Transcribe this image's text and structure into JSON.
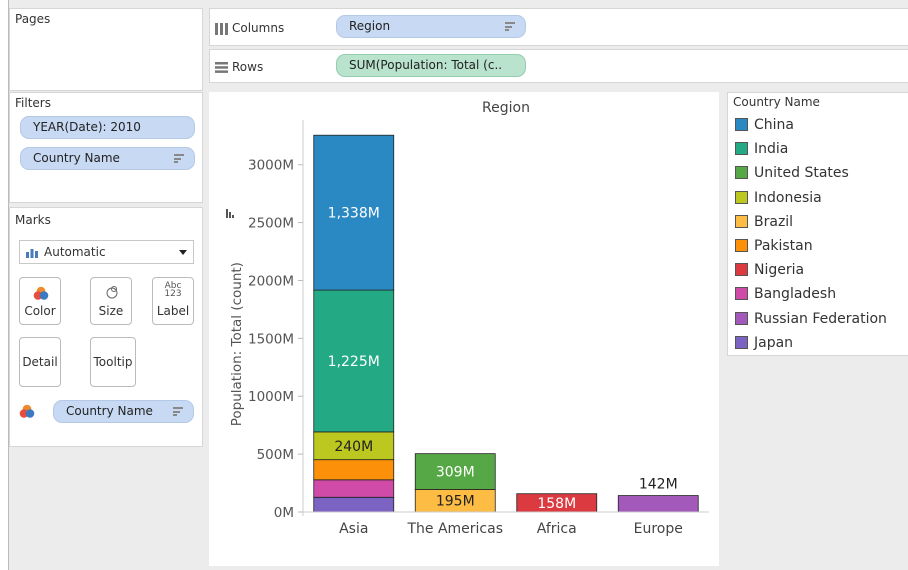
{
  "shelves": {
    "pages_title": "Pages",
    "columns_label": "Columns",
    "rows_label": "Rows",
    "columns_pill": "Region",
    "rows_pill": "SUM(Population: Total (c.."
  },
  "filters": {
    "title": "Filters",
    "items": [
      "YEAR(Date): 2010",
      "Country Name"
    ]
  },
  "marks": {
    "title": "Marks",
    "mark_type": "Automatic",
    "buttons": {
      "color": "Color",
      "size": "Size",
      "label": "Label",
      "label_icon_top": "Abc",
      "label_icon_bottom": "123",
      "detail": "Detail",
      "tooltip": "Tooltip"
    },
    "color_pill": "Country Name"
  },
  "legend": {
    "title": "Country Name",
    "items": [
      {
        "name": "China",
        "color": "#2a88c2"
      },
      {
        "name": "India",
        "color": "#23aa85"
      },
      {
        "name": "United States",
        "color": "#55a845"
      },
      {
        "name": "Indonesia",
        "color": "#bcc71f"
      },
      {
        "name": "Brazil",
        "color": "#fdbc43"
      },
      {
        "name": "Pakistan",
        "color": "#fc9009"
      },
      {
        "name": "Nigeria",
        "color": "#da3a40"
      },
      {
        "name": "Bangladesh",
        "color": "#d04ba8"
      },
      {
        "name": "Russian Federation",
        "color": "#a359b9"
      },
      {
        "name": "Japan",
        "color": "#7b63c4"
      }
    ]
  },
  "chart_data": {
    "type": "bar",
    "title": "Region",
    "xlabel": "",
    "ylabel": "Population: Total (count)",
    "categories": [
      "Asia",
      "The Americas",
      "Africa",
      "Europe"
    ],
    "ylim": [
      0,
      3300
    ],
    "yticks": [
      0,
      500,
      1000,
      1500,
      2000,
      2500,
      3000
    ],
    "ytick_labels": [
      "0M",
      "500M",
      "1000M",
      "1500M",
      "2000M",
      "2500M",
      "3000M"
    ],
    "stacked": true,
    "series": [
      {
        "name": "Japan",
        "values": [
          127,
          0,
          0,
          0
        ]
      },
      {
        "name": "Bangladesh",
        "values": [
          151,
          0,
          0,
          0
        ]
      },
      {
        "name": "Pakistan",
        "values": [
          174,
          0,
          0,
          0
        ]
      },
      {
        "name": "Indonesia",
        "values": [
          240,
          0,
          0,
          0
        ]
      },
      {
        "name": "India",
        "values": [
          1225,
          0,
          0,
          0
        ]
      },
      {
        "name": "China",
        "values": [
          1338,
          0,
          0,
          0
        ]
      },
      {
        "name": "Brazil",
        "values": [
          0,
          195,
          0,
          0
        ]
      },
      {
        "name": "United States",
        "values": [
          0,
          309,
          0,
          0
        ]
      },
      {
        "name": "Nigeria",
        "values": [
          0,
          0,
          158,
          0
        ]
      },
      {
        "name": "Russian Federation",
        "values": [
          0,
          0,
          0,
          142
        ]
      }
    ],
    "data_labels": [
      {
        "series": "China",
        "category": "Asia",
        "text": "1,338M"
      },
      {
        "series": "India",
        "category": "Asia",
        "text": "1,225M"
      },
      {
        "series": "Indonesia",
        "category": "Asia",
        "text": "240M"
      },
      {
        "series": "United States",
        "category": "The Americas",
        "text": "309M"
      },
      {
        "series": "Brazil",
        "category": "The Americas",
        "text": "195M"
      },
      {
        "series": "Nigeria",
        "category": "Africa",
        "text": "158M"
      },
      {
        "series": "Russian Federation",
        "category": "Europe",
        "text": "142M",
        "outside": true
      }
    ],
    "legend_position": "right",
    "grid": false
  }
}
